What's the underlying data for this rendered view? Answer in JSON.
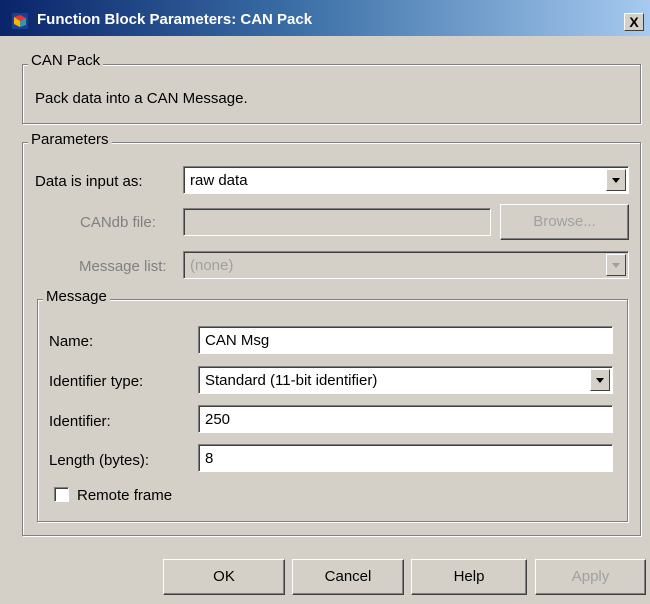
{
  "window": {
    "title": "Function Block Parameters: CAN Pack",
    "close_label": "X"
  },
  "description_group": {
    "legend": "CAN Pack",
    "text": "Pack data into a CAN Message."
  },
  "parameters": {
    "legend": "Parameters",
    "data_input_label": "Data is input as:",
    "data_input_value": "raw data",
    "candb_label": "CANdb file:",
    "candb_value": "",
    "browse_label": "Browse...",
    "message_list_label": "Message list:",
    "message_list_value": "(none)"
  },
  "message": {
    "legend": "Message",
    "name_label": "Name:",
    "name_value": "CAN Msg",
    "identifier_type_label": "Identifier type:",
    "identifier_type_value": "Standard (11-bit identifier)",
    "identifier_label": "Identifier:",
    "identifier_value": "250",
    "length_label": "Length (bytes):",
    "length_value": "8",
    "remote_frame_label": "Remote frame",
    "remote_frame_checked": false
  },
  "buttons": {
    "ok": "OK",
    "cancel": "Cancel",
    "help": "Help",
    "apply": "Apply"
  },
  "icons": {
    "title": "simulink-block-icon",
    "close": "close-icon",
    "dropdown": "chevron-down-icon"
  }
}
